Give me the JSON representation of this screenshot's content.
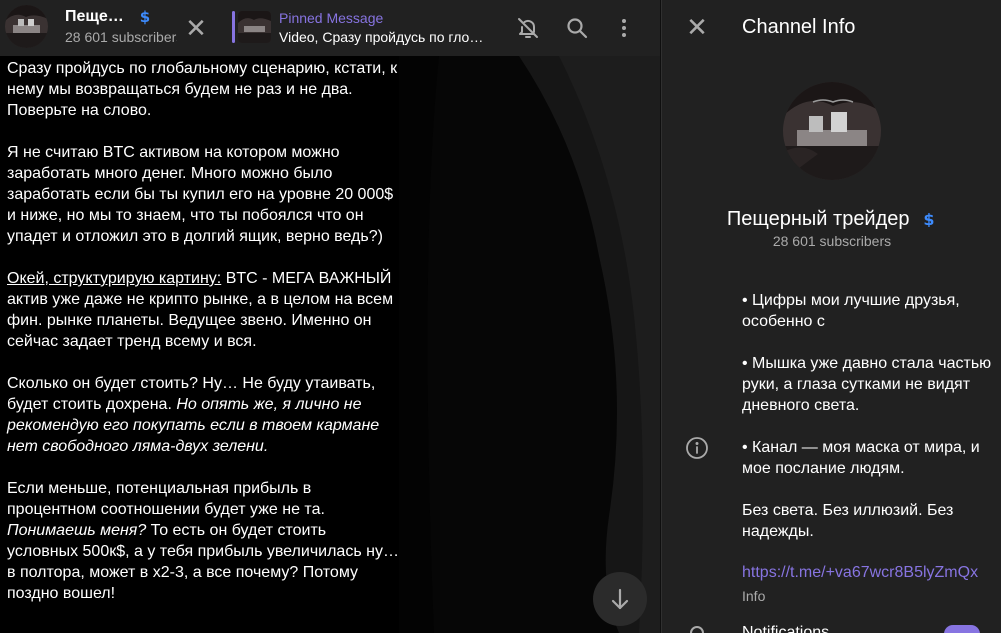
{
  "header": {
    "channel_title": "Пещерный трейдер",
    "subscribers": "28 601 subscribers",
    "pinned_label": "Pinned Message",
    "pinned_text": "Video, Сразу пройдусь по глобальному сценарию, кстати, к нему мы возвращаться будем не раз и не два. Поверьте на слово."
  },
  "message": {
    "p1": "Сразу пройдусь по глобальному сценарию, кстати, к нему мы возвращаться будем не раз и не два. Поверьте на слово.",
    "p2": "Я не считаю BTC активом на котором можно заработать много денег. Много можно было заработать если бы ты купил его на уровне 20 000$ и ниже, но мы то знаем, что ты побоялся что он упадет и отложил это в долгий ящик, верно ведь?)",
    "p3_underline": "Окей, структурирую картину:",
    "p3_rest": " BTC - МЕГА ВАЖНЫЙ актив уже даже не крипто рынке, а в целом на всем фин. рынке планеты. Ведущее звено. Именно он сейчас задает тренд всему и вся.",
    "p4_plain": "Сколько он будет стоить? Ну… Не буду утаивать, будет стоить дохрена. ",
    "p4_italic": "Но опять же, я лично не рекомендую его покупать если в твоем кармане нет свободного ляма-двух зелени.",
    "p5_plain": "Если меньше, потенциальная прибыль в процентном соотношении будет уже не та. ",
    "p5_italic": "Понимаешь меня?",
    "p5_rest": " То есть он будет стоить условных 500к$, а у тебя прибыль увеличилась ну… в полтора, может в х2-3, а все почему? Потому поздно вошел!"
  },
  "info": {
    "title": "Channel Info",
    "name": "Пещерный трейдер",
    "subscribers": "28 601 subscribers",
    "desc1": "• Цифры мои лучшие друзья, особенно с",
    "desc2": "• Мышка уже давно стала частью руки, а глаза сутками не видят дневного света.",
    "desc3": "• Канал — моя маска от мира, и мое послание людям.",
    "desc4": "Без света. Без иллюзий. Без надежды.",
    "link": "https://t.me/+va67wcr8B5lyZmQx",
    "link_label": "Info",
    "notifications": "Notifications",
    "notifications_on": true
  },
  "colors": {
    "accent": "#8774e1",
    "verified": "#3d8bfd",
    "panel": "#212121",
    "muted": "#aaaaaa"
  },
  "icons": [
    "verified-icon",
    "close-icon",
    "mute-bell-icon",
    "search-icon",
    "more-vertical-icon",
    "arrow-down-icon",
    "info-icon",
    "bell-icon"
  ]
}
